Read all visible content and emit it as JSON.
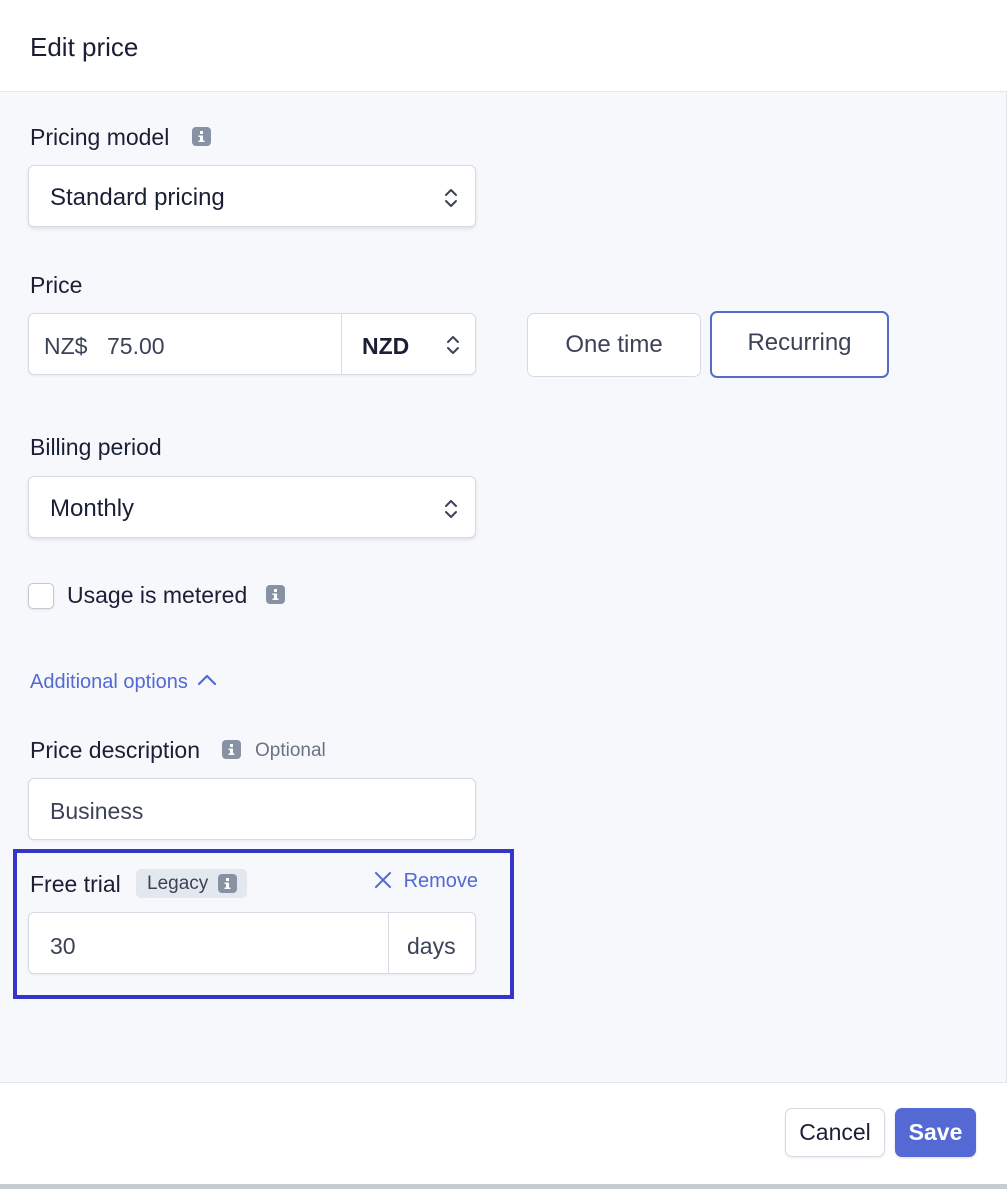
{
  "dialog": {
    "title": "Edit price"
  },
  "pricing_model": {
    "label": "Pricing model",
    "info_icon": "info-icon",
    "selected": "Standard pricing"
  },
  "price": {
    "label": "Price",
    "prefix": "NZ$",
    "amount": "75.00",
    "currency": "NZD",
    "type_options": [
      "One time",
      "Recurring"
    ],
    "selected_type": "Recurring"
  },
  "billing_period": {
    "label": "Billing period",
    "selected": "Monthly"
  },
  "usage_metered": {
    "label": "Usage is metered",
    "checked": false,
    "info_icon": "info-icon"
  },
  "additional_options": {
    "label": "Additional options",
    "icon": "chevron-up-icon"
  },
  "price_description": {
    "label": "Price description",
    "optional_text": "Optional",
    "value": "Business"
  },
  "free_trial": {
    "label": "Free trial",
    "badge": "Legacy",
    "remove_label": "Remove",
    "value": "30",
    "unit": "days"
  },
  "footer": {
    "cancel_label": "Cancel",
    "save_label": "Save"
  },
  "colors": {
    "accent": "#5469d4",
    "highlight_border": "#3535c7",
    "background": "#f6f8fb"
  }
}
